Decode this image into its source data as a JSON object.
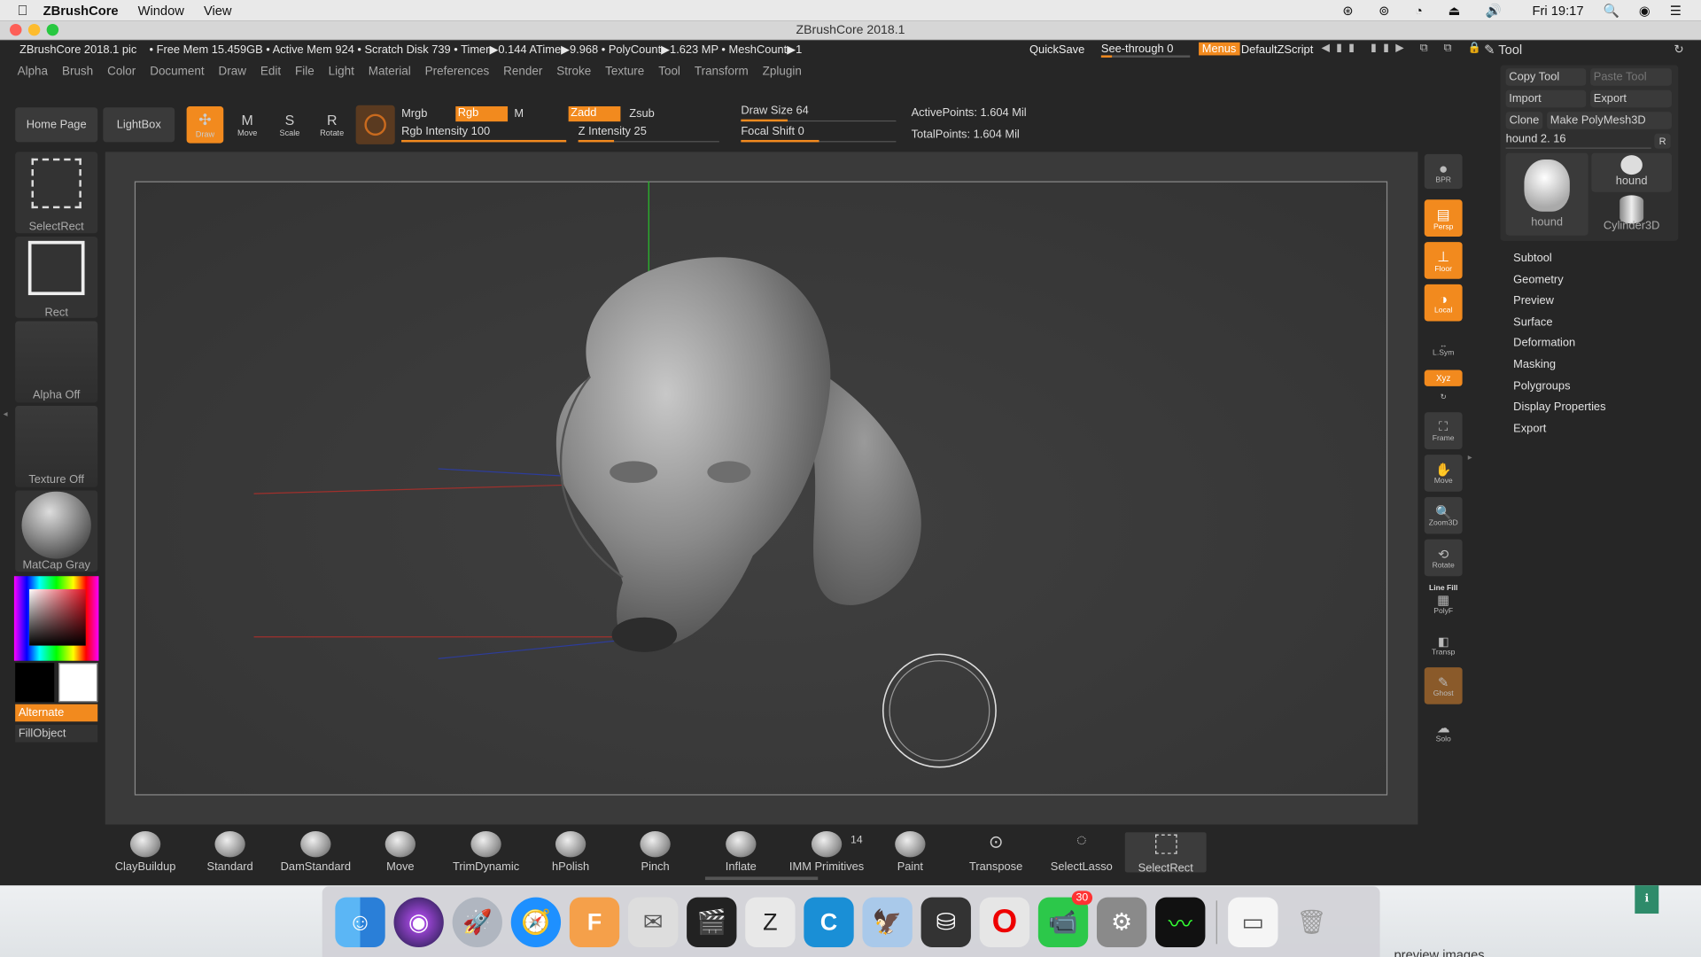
{
  "mac_menubar": {
    "app": "ZBrushCore",
    "items": [
      "Window",
      "View"
    ],
    "clock": "Fri 19:17"
  },
  "window_title": "ZBrushCore 2018.1",
  "status": {
    "doc": "ZBrushCore 2018.1 pic",
    "free_mem": "• Free Mem 15.459GB",
    "active_mem": "• Active Mem 924",
    "scratch": "• Scratch Disk 739",
    "timer": "• Timer▶0.144 ATime▶9.968",
    "polycount": "• PolyCount▶1.623 MP",
    "meshcount": "• MeshCount▶1"
  },
  "top_right": {
    "quicksave": "QuickSave",
    "seethrough": "See-through 0",
    "menus": "Menus",
    "script": "DefaultZScript"
  },
  "tool_title": "Tool",
  "main_menu": [
    "Alpha",
    "Brush",
    "Color",
    "Document",
    "Draw",
    "Edit",
    "File",
    "Light",
    "Material",
    "Preferences",
    "Render",
    "Stroke",
    "Texture",
    "Tool",
    "Transform",
    "Zplugin"
  ],
  "toolbar": {
    "home": "Home Page",
    "lightbox": "LightBox",
    "draw": "Draw",
    "move": "Move",
    "scale": "Scale",
    "rotate": "Rotate",
    "mrgb": "Mrgb",
    "rgb": "Rgb",
    "m": "M",
    "zadd": "Zadd",
    "zsub": "Zsub",
    "rgb_intensity": "Rgb Intensity 100",
    "z_intensity": "Z Intensity 25",
    "draw_size": "Draw Size 64",
    "focal_shift": "Focal Shift 0",
    "active_points": "ActivePoints: 1.604 Mil",
    "total_points": "TotalPoints: 1.604 Mil"
  },
  "levels": {
    "rgb_intensity": 1.0,
    "z_intensity": 0.25,
    "draw_size": 0.3,
    "focal_shift": 0.5
  },
  "left_panel": {
    "selectrect": "SelectRect",
    "rect": "Rect",
    "alpha": "Alpha Off",
    "texture": "Texture Off",
    "matcap": "MatCap Gray",
    "alternate": "Alternate",
    "fillobject": "FillObject"
  },
  "right_tools": {
    "bpr": "BPR",
    "persp": "Persp",
    "floor": "Floor",
    "local": "Local",
    "lsym": "L.Sym",
    "xyz": "Xyz",
    "frame": "Frame",
    "move": "Move",
    "zoom": "Zoom3D",
    "rotate": "Rotate",
    "linefill": "Line Fill",
    "polyf": "PolyF",
    "transp": "Transp",
    "ghost": "Ghost",
    "solo": "Solo"
  },
  "tool_panel": {
    "copy": "Copy Tool",
    "paste": "Paste Tool",
    "import": "Import",
    "export": "Export",
    "clone": "Clone",
    "polymesh": "Make PolyMesh3D",
    "hound_value": "hound 2. 16",
    "r": "R",
    "thumb1": "hound",
    "thumb2": "hound",
    "thumb3": "Cylinder3D"
  },
  "palette": [
    "Subtool",
    "Geometry",
    "Preview",
    "Surface",
    "Deformation",
    "Masking",
    "Polygroups",
    "Display Properties",
    "Export"
  ],
  "brushes": [
    {
      "label": "ClayBuildup"
    },
    {
      "label": "Standard"
    },
    {
      "label": "DamStandard"
    },
    {
      "label": "Move"
    },
    {
      "label": "TrimDynamic"
    },
    {
      "label": "hPolish"
    },
    {
      "label": "Pinch"
    },
    {
      "label": "Inflate"
    },
    {
      "label": "IMM Primitives",
      "badge": "14"
    },
    {
      "label": "Paint"
    },
    {
      "label": "Transpose"
    },
    {
      "label": "SelectLasso"
    },
    {
      "label": "SelectRect"
    }
  ],
  "dock_badge": "30",
  "dock_apps": [
    "finder-icon",
    "siri-icon",
    "launchpad-icon",
    "safari-icon",
    "fusion360-icon",
    "mail-stamp-icon",
    "finalcut-icon",
    "zbrush-icon",
    "cinema-icon",
    "preview-icon",
    "disk-utility-icon",
    "opera-icon",
    "facetime-icon",
    "system-prefs-icon",
    "activity-monitor-icon",
    "files-icon",
    "trash-icon"
  ],
  "desktop_text": "preview images"
}
